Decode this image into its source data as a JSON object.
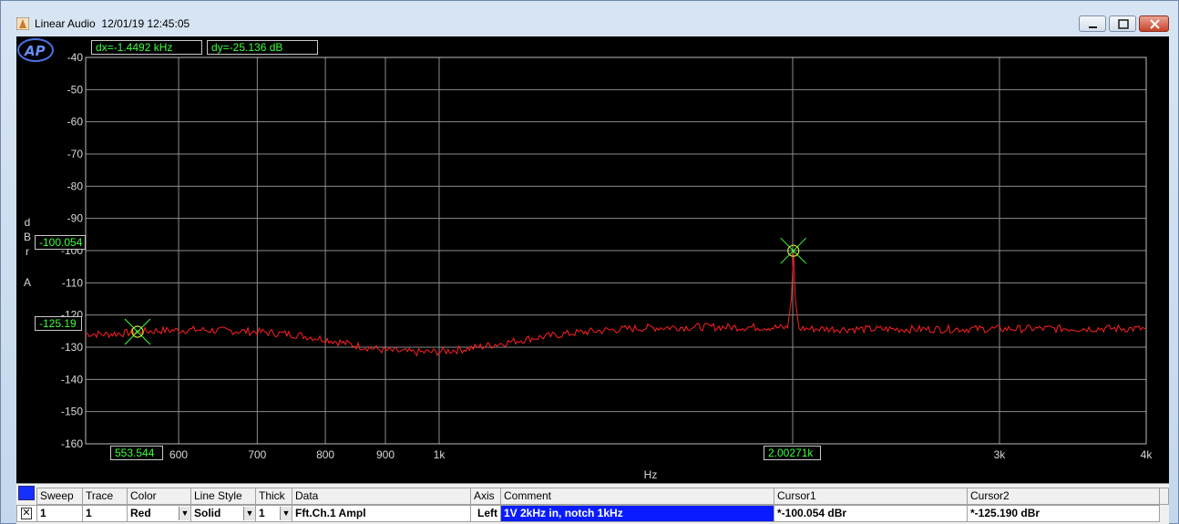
{
  "window": {
    "app_name": "Linear Audio",
    "timestamp": "12/01/19 12:45:05",
    "minimize_label": "—",
    "maximize_label": "□",
    "close_label": "✕"
  },
  "plot": {
    "dx_readout": "dx=-1.4492 kHz",
    "dy_readout": "dy=-25.136  dB",
    "cursor1_y_readout": "-100.054",
    "cursor2_y_readout": "-125.19",
    "cursor2_x_readout": "553.544",
    "cursor1_x_readout": "2.00271k",
    "y_label_top": "dBr",
    "y_label_bottom": "A",
    "logo_text": "AP"
  },
  "chart_data": {
    "type": "line",
    "x_scale": "log",
    "xlim": [
      500,
      4000
    ],
    "ylim": [
      -160,
      -40
    ],
    "xlabel": "Hz",
    "ylabel": "dBr A",
    "grid": true,
    "x_ticks": [
      {
        "value": 600,
        "label": "600"
      },
      {
        "value": 700,
        "label": "700"
      },
      {
        "value": 800,
        "label": "800"
      },
      {
        "value": 900,
        "label": "900"
      },
      {
        "value": 1000,
        "label": "1k"
      },
      {
        "value": 3000,
        "label": "3k"
      },
      {
        "value": 4000,
        "label": "4k"
      }
    ],
    "x_minor_grid": [
      2000
    ],
    "y_ticks": [
      -40,
      -50,
      -60,
      -70,
      -80,
      -90,
      -100,
      -110,
      -120,
      -130,
      -140,
      -150,
      -160
    ],
    "series": [
      {
        "color": "#ff2020",
        "points": [
          [
            500,
            -125.8
          ],
          [
            520,
            -126.0
          ],
          [
            540,
            -125.6
          ],
          [
            553.544,
            -125.19
          ],
          [
            580,
            -124.8
          ],
          [
            620,
            -124.6
          ],
          [
            660,
            -124.9
          ],
          [
            700,
            -125.2
          ],
          [
            750,
            -126.0
          ],
          [
            800,
            -127.5
          ],
          [
            850,
            -129.5
          ],
          [
            900,
            -131.0
          ],
          [
            950,
            -131.6
          ],
          [
            1000,
            -131.4
          ],
          [
            1050,
            -130.6
          ],
          [
            1100,
            -129.5
          ],
          [
            1200,
            -127.2
          ],
          [
            1300,
            -125.6
          ],
          [
            1400,
            -124.6
          ],
          [
            1500,
            -124.0
          ],
          [
            1600,
            -123.8
          ],
          [
            1700,
            -123.7
          ],
          [
            1800,
            -123.8
          ],
          [
            1900,
            -123.8
          ],
          [
            1980,
            -124.0
          ],
          [
            1995,
            -115.0
          ],
          [
            2002.71,
            -100.054
          ],
          [
            2010,
            -115.0
          ],
          [
            2025,
            -124.2
          ],
          [
            2100,
            -124.3
          ],
          [
            2300,
            -124.4
          ],
          [
            2600,
            -124.4
          ],
          [
            3000,
            -124.3
          ],
          [
            3400,
            -124.2
          ],
          [
            3800,
            -124.2
          ],
          [
            4000,
            -124.3
          ]
        ]
      }
    ],
    "cursors": [
      {
        "name": "Cursor1",
        "x": 2002.71,
        "y": -100.054
      },
      {
        "name": "Cursor2",
        "x": 553.544,
        "y": -125.19
      }
    ]
  },
  "table": {
    "headers": {
      "sweep": "Sweep",
      "trace": "Trace",
      "color": "Color",
      "line_style": "Line Style",
      "thick": "Thick",
      "data": "Data",
      "axis": "Axis",
      "comment": "Comment",
      "cursor1": "Cursor1",
      "cursor2": "Cursor2"
    },
    "row": {
      "enabled_mark": "✕",
      "sweep": "1",
      "trace": "1",
      "color": "Red",
      "line_style": "Solid",
      "thick": "1",
      "data": "Fft.Ch.1 Ampl",
      "axis": "Left",
      "comment": "1V 2kHz in, notch 1kHz",
      "cursor1": "*-100.054 dBr",
      "cursor2": "*-125.190 dBr"
    }
  }
}
